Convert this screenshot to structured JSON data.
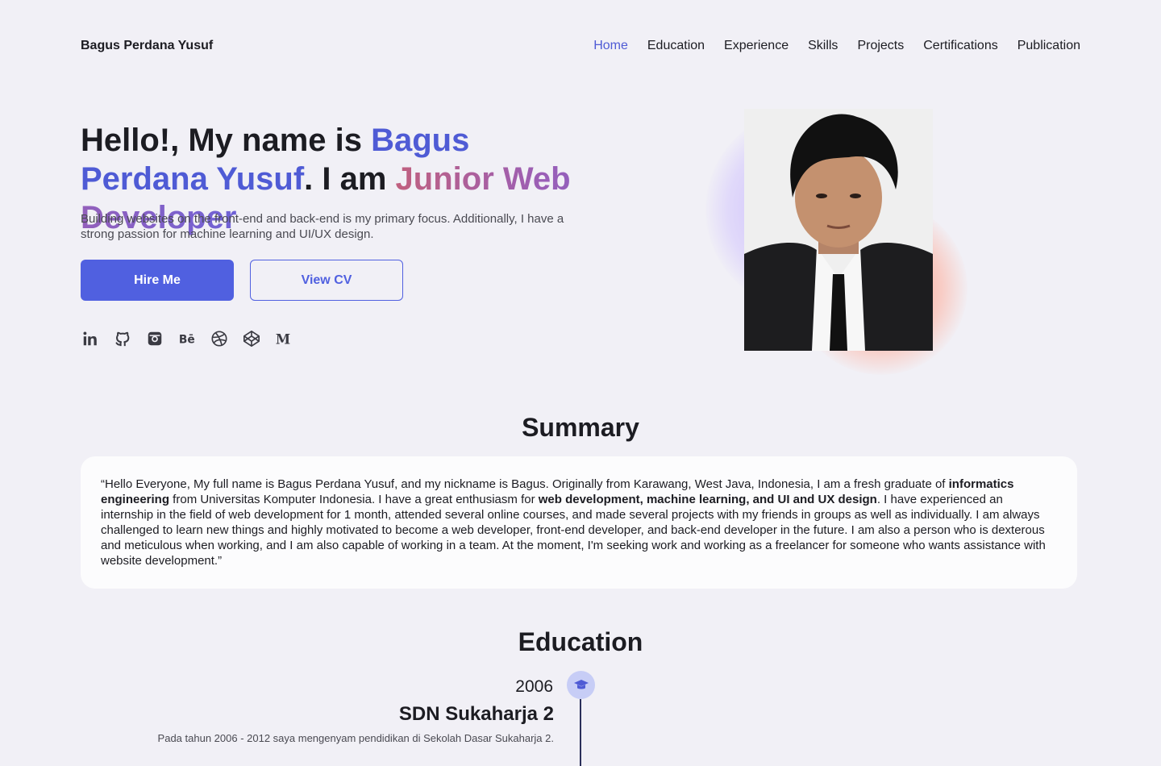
{
  "brand": "Bagus Perdana Yusuf",
  "nav": {
    "items": [
      "Home",
      "Education",
      "Experience",
      "Skills",
      "Projects",
      "Certifications",
      "Publication"
    ],
    "active": "Home"
  },
  "hero": {
    "title_part1": "Hello!, My name is ",
    "title_name": "Bagus Perdana Yusuf",
    "title_part2": ". I am ",
    "title_role": "Junior Web Developer",
    "description": "Building websites on the front-end and back-end is my primary focus. Additionally, I have a strong passion for machine learning and UI/UX design.",
    "hire_label": "Hire Me",
    "cv_label": "View CV"
  },
  "socials": [
    "linkedin-icon",
    "github-icon",
    "instagram-icon",
    "behance-icon",
    "dribbble-icon",
    "codepen-icon",
    "medium-icon"
  ],
  "summary": {
    "title": "Summary",
    "t1": "“Hello Everyone, My full name is Bagus Perdana Yusuf, and my nickname is Bagus. Originally from Karawang, West Java, Indonesia, I am a fresh graduate of ",
    "b1": "informatics engineering",
    "t2": " from Universitas Komputer Indonesia. I have a great enthusiasm for ",
    "b2": "web development, machine learning, and UI and UX design",
    "t3": ". I have experienced an internship in the field of web development for 1 month, attended several online courses, and made several projects with my friends in groups as well as individually. I am always challenged to learn new things and highly motivated to become a web developer, front-end developer, and back-end developer in the future. I am also a person who is dexterous and meticulous when working, and I am also capable of working in a team. At the moment, I'm seeking work and working as a freelancer for someone who wants assistance with website development.”"
  },
  "education": {
    "title": "Education",
    "items": [
      {
        "year": "2006",
        "school": "SDN Sukaharja 2",
        "description": "Pada tahun 2006 - 2012 saya mengenyam pendidikan di Sekolah Dasar Sukaharja 2."
      }
    ]
  },
  "colors": {
    "accent": "#5060e0",
    "background": "#f1f0f6"
  }
}
